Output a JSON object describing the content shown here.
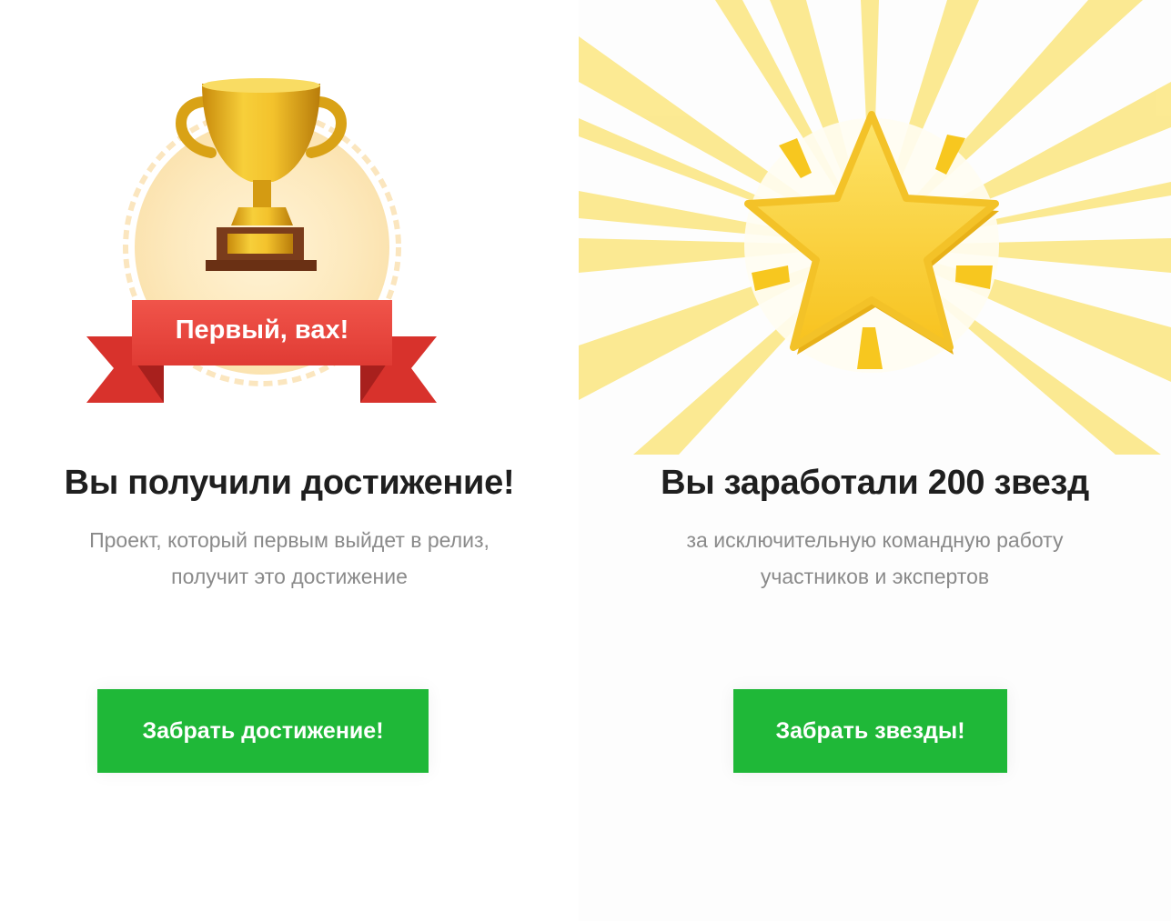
{
  "left_card": {
    "ribbon_text": "Первый, вах!",
    "title": "Вы получили достижение!",
    "description_line1": "Проект, который первым выйдет в релиз,",
    "description_line2": "получит это достижение",
    "button_label": "Забрать достижение!",
    "icon": "trophy-icon"
  },
  "right_card": {
    "title": "Вы заработали 200 звезд",
    "description_line1": "за исключительную командную работу",
    "description_line2": "участников и экспертов",
    "button_label": "Забрать звезды!",
    "icon": "star-icon"
  },
  "colors": {
    "button_green": "#1fb838",
    "ribbon_red": "#e8403b",
    "trophy_gold": "#e5b319",
    "star_yellow": "#fcd22f"
  }
}
